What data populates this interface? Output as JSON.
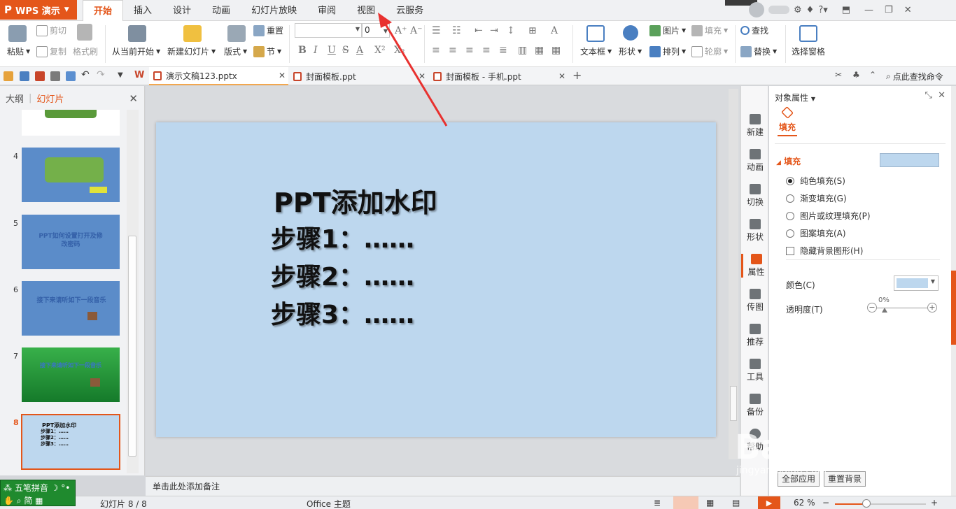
{
  "app": {
    "name": "WPS 演示",
    "logo": "P"
  },
  "menu": {
    "tabs": [
      "开始",
      "插入",
      "设计",
      "动画",
      "幻灯片放映",
      "审阅",
      "视图",
      "云服务"
    ],
    "active_index": 0
  },
  "ribbon": {
    "paste": "粘贴",
    "cut": "剪切",
    "copy": "复制",
    "format_painter": "格式刷",
    "from_current": "从当前开始",
    "new_slide": "新建幻灯片",
    "layout": "版式",
    "reset": "重置",
    "section": "节",
    "font_size": "0",
    "bold": "B",
    "italic": "I",
    "underline": "U",
    "strike": "S",
    "font_color": "A",
    "superscript": "X²",
    "subscript": "X₂",
    "textbox": "文本框",
    "shape": "形状",
    "picture": "图片",
    "fill": "填充",
    "arrange": "排列",
    "outline": "轮廓",
    "find": "查找",
    "replace": "替换",
    "selection_pane": "选择窗格"
  },
  "doc_tabs": [
    {
      "label": "演示文稿123.pptx",
      "active": true
    },
    {
      "label": "封面模板.ppt",
      "active": false
    },
    {
      "label": "封面模板 - 手机.ppt",
      "active": false
    }
  ],
  "search_cmd": "点此查找命令",
  "left_panel": {
    "tab_outline": "大纲",
    "tab_slides": "幻灯片",
    "thumbs": [
      {
        "num": "4",
        "text": ""
      },
      {
        "num": "5",
        "text": "PPT如何设置打开及修改密码"
      },
      {
        "num": "6",
        "text": "接下来请听如下一段音乐"
      },
      {
        "num": "7",
        "text": "接下来请听如下一段音乐"
      },
      {
        "num": "8",
        "text": "PPT添加水印"
      }
    ],
    "thumb8_lines": [
      "PPT添加水印",
      "步骤1：……",
      "步骤2：……",
      "步骤3：……"
    ]
  },
  "slide": {
    "title": "PPT添加水印",
    "lines": [
      "步骤1：……",
      "步骤2：……",
      "步骤3：……"
    ],
    "background": "#bdd7ee"
  },
  "notes_placeholder": "单击此处添加备注",
  "side_strip": [
    "新建",
    "动画",
    "切换",
    "形状",
    "属性",
    "传图",
    "推荐",
    "工具",
    "备份",
    "帮助"
  ],
  "props": {
    "title": "对象属性",
    "tab_fill": "填充",
    "section_fill": "填充",
    "options": [
      "纯色填充(S)",
      "渐变填充(G)",
      "图片或纹理填充(P)",
      "图案填充(A)"
    ],
    "hide_bg": "隐藏背景图形(H)",
    "color_label": "颜色(C)",
    "transparency_label": "透明度(T)",
    "transparency_value": "0%",
    "apply_all": "全部应用",
    "reset_bg": "重置背景",
    "fill_color": "#bdd7ee"
  },
  "status": {
    "slide_info": "幻灯片 8 / 8",
    "theme": "Office 主题",
    "zoom": "62 %",
    "zoom_value": 62
  },
  "ime": {
    "line1": "五笔拼音",
    "line2": "简"
  },
  "watermark": {
    "line1": "Bai du 经验",
    "line2": "jingyan.baidu.com"
  },
  "colors": {
    "accent": "#e4561a",
    "slide_bg": "#bdd7ee"
  }
}
